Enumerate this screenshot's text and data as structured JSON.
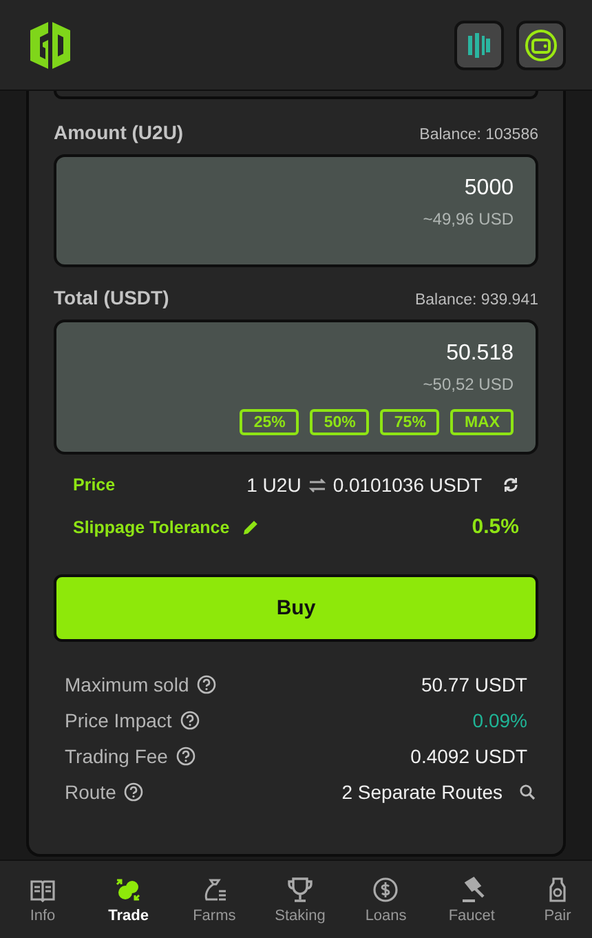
{
  "fields": [
    {
      "label": "Amount (U2U)",
      "balance": "Balance: 103586",
      "value": "5000",
      "usd": "~49,96 USD"
    },
    {
      "label": "Total (USDT)",
      "balance": "Balance: 939.941",
      "value": "50.518",
      "usd": "~50,52 USD",
      "percent_buttons": [
        "25%",
        "50%",
        "75%",
        "MAX"
      ]
    }
  ],
  "price": {
    "label": "Price",
    "base": "1 U2U",
    "quote": "0.0101036 USDT"
  },
  "slippage": {
    "label": "Slippage Tolerance",
    "value": "0.5%"
  },
  "buy_button": "Buy",
  "details": [
    {
      "label": "Maximum sold",
      "value": "50.77 USDT",
      "kind": "plain"
    },
    {
      "label": "Price Impact",
      "value": "0.09%",
      "kind": "impact"
    },
    {
      "label": "Trading Fee",
      "value": "0.4092 USDT",
      "kind": "plain"
    },
    {
      "label": "Route",
      "value": "2 Separate Routes",
      "kind": "route"
    }
  ],
  "nav": [
    {
      "label": "Info",
      "kind": "book",
      "selected": false
    },
    {
      "label": "Trade",
      "kind": "trade",
      "selected": true
    },
    {
      "label": "Farms",
      "kind": "bag",
      "selected": false
    },
    {
      "label": "Staking",
      "kind": "trophy",
      "selected": false
    },
    {
      "label": "Loans",
      "kind": "coin",
      "selected": false
    },
    {
      "label": "Faucet",
      "kind": "gavel",
      "selected": false
    },
    {
      "label": "Pair",
      "kind": "bottle",
      "selected": false
    }
  ]
}
